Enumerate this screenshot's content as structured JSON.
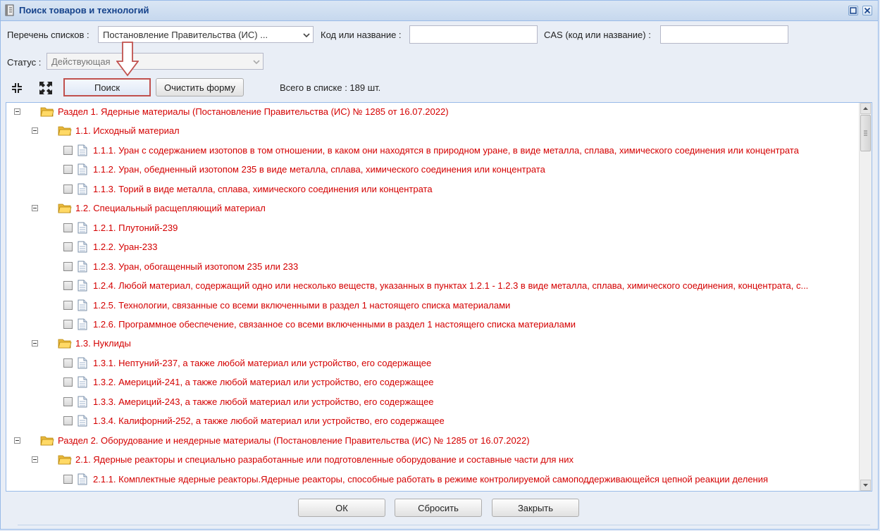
{
  "window": {
    "title": "Поиск товаров и технологий",
    "icon": "book-icon"
  },
  "form": {
    "list_label": "Перечень списков :",
    "list_value": "Постановление Правительства (ИС) ...",
    "code_label": "Код или название :",
    "code_value": "",
    "cas_label": "CAS (код или название) :",
    "cas_value": "",
    "status_label": "Статус :",
    "status_value": "Действующая"
  },
  "toolbar": {
    "collapse_icon": "collapse-all-icon",
    "expand_icon": "expand-all-icon",
    "search_label": "Поиск",
    "clear_label": "Очистить форму",
    "total_text": "Всего в списке : 189 шт."
  },
  "tree": [
    {
      "level": 0,
      "type": "folder",
      "text": "Раздел 1. Ядерные материалы (Постановление Правительства (ИС) № 1285 от 16.07.2022)"
    },
    {
      "level": 1,
      "type": "folder",
      "text": "1.1. Исходный материал"
    },
    {
      "level": 2,
      "type": "leaf",
      "text": "1.1.1. Уран с содержанием изотопов в том отношении, в каком они находятся в природном уране, в виде металла, сплава, химического соединения или концентрата"
    },
    {
      "level": 2,
      "type": "leaf",
      "text": "1.1.2. Уран, обедненный изотопом 235 в виде металла, сплава, химического соединения или концентрата"
    },
    {
      "level": 2,
      "type": "leaf",
      "text": "1.1.3. Торий в виде металла, сплава, химического соединения или концентрата"
    },
    {
      "level": 1,
      "type": "folder",
      "text": "1.2. Специальный расщепляющий материал"
    },
    {
      "level": 2,
      "type": "leaf",
      "text": "1.2.1. Плутоний-239"
    },
    {
      "level": 2,
      "type": "leaf",
      "text": "1.2.2. Уран-233"
    },
    {
      "level": 2,
      "type": "leaf",
      "text": "1.2.3. Уран, обогащенный изотопом 235 или 233"
    },
    {
      "level": 2,
      "type": "leaf",
      "text": "1.2.4. Любой материал, содержащий одно или несколько веществ, указанных в пунктах 1.2.1 - 1.2.3 в виде металла, сплава, химического соединения, концентрата, с..."
    },
    {
      "level": 2,
      "type": "leaf",
      "text": "1.2.5. Технологии, связанные со всеми включенными в раздел 1 настоящего списка материалами"
    },
    {
      "level": 2,
      "type": "leaf",
      "text": "1.2.6. Программное обеспечение, связанное со всеми включенными в раздел 1 настоящего списка материалами"
    },
    {
      "level": 1,
      "type": "folder",
      "text": "1.3. Нуклиды"
    },
    {
      "level": 2,
      "type": "leaf",
      "text": "1.3.1. Нептуний-237, а также любой материал или устройство, его содержащее"
    },
    {
      "level": 2,
      "type": "leaf",
      "text": "1.3.2. Америций-241, а также любой материал или устройство, его содержащее"
    },
    {
      "level": 2,
      "type": "leaf",
      "text": "1.3.3. Америций-243, а также любой материал или устройство, его содержащее"
    },
    {
      "level": 2,
      "type": "leaf",
      "text": "1.3.4. Калифорний-252, а также любой материал или устройство, его содержащее"
    },
    {
      "level": 0,
      "type": "folder",
      "text": "Раздел 2. Оборудование и неядерные материалы (Постановление Правительства (ИС) № 1285 от 16.07.2022)"
    },
    {
      "level": 1,
      "type": "folder",
      "text": "2.1. Ядерные реакторы и специально разработанные или подготовленные оборудование и составные части для них"
    },
    {
      "level": 2,
      "type": "leaf",
      "text": "2.1.1. Комплектные ядерные реакторы.Ядерные реакторы, способные работать в режиме контролируемой самоподдерживающейся цепной реакции деления"
    }
  ],
  "footer": {
    "ok_label": "ОК",
    "reset_label": "Сбросить",
    "close_label": "Закрыть"
  },
  "colors": {
    "item_text": "#d40000",
    "highlight_border": "#c0504d",
    "folder": "#f2c94c"
  }
}
